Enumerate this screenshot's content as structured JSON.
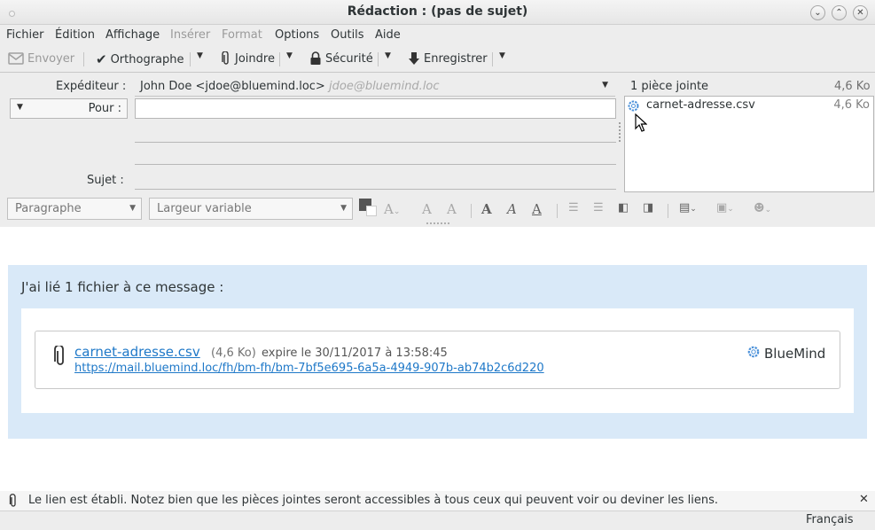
{
  "window": {
    "title": "Rédaction : (pas de sujet)"
  },
  "menubar": {
    "items": [
      "Fichier",
      "Édition",
      "Affichage",
      "Insérer",
      "Format",
      "Options",
      "Outils",
      "Aide"
    ]
  },
  "toolbar": {
    "send": "Envoyer",
    "spelling": "Orthographe",
    "attach": "Joindre",
    "security": "Sécurité",
    "save": "Enregistrer"
  },
  "compose": {
    "from_label": "Expéditeur :",
    "from_value": "John Doe <jdoe@bluemind.loc>",
    "from_hint": "jdoe@bluemind.loc",
    "to_type": "Pour :",
    "to_value": "",
    "subject_label": "Sujet :",
    "subject_value": ""
  },
  "attachments": {
    "header": "1 pièce jointe",
    "total_size": "4,6 Ko",
    "items": [
      {
        "name": "carnet-adresse.csv",
        "size": "4,6 Ko"
      }
    ]
  },
  "format_bar": {
    "paragraph": "Paragraphe",
    "font": "Largeur variable"
  },
  "message": {
    "intro": "J'ai lié 1 fichier à ce message :",
    "file_name": "carnet-adresse.csv",
    "file_meta": "(4,6 Ko)",
    "expiry": "expire le 30/11/2017 à 13:58:45",
    "link": "https://mail.bluemind.loc/fh/bm-fh/bm-7bf5e695-6a5a-4949-907b-ab74b2c6d220",
    "brand": "BlueMind"
  },
  "notification": {
    "text": "Le lien est établi. Notez bien que les pièces jointes seront accessibles à tous ceux qui peuvent voir ou deviner les liens."
  },
  "status": {
    "language": "Français"
  },
  "colors": {
    "accent": "#1e78c8",
    "panel_blue": "#d9e9f8",
    "bluemind": "#4a90d9"
  }
}
